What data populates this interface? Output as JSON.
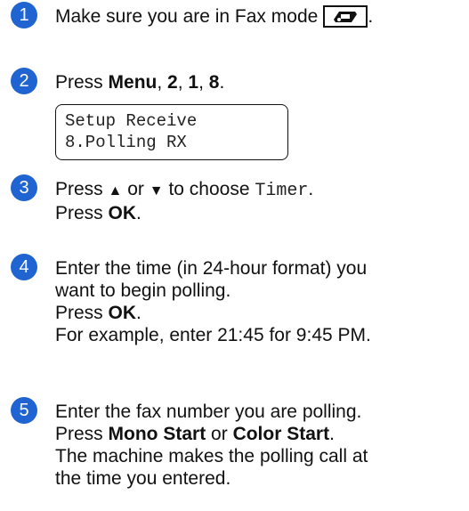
{
  "steps": [
    {
      "number": "1",
      "lines": [
        {
          "text": "Make sure you are in Fax mode",
          "key_icon": "fax-mode-icon",
          "after": "."
        }
      ]
    },
    {
      "number": "2",
      "press": "Press",
      "menu": "Menu",
      "sep1": ",",
      "k2": "2",
      "sep2": ",",
      "k1": "1",
      "sep3": ",",
      "k8": "8",
      "end": "."
    },
    {
      "number": "3",
      "line1_press": "Press",
      "up_glyph": "▲",
      "or": "or",
      "down_glyph": "▼",
      "to_choose": "to choose",
      "option": "Timer",
      "line1_end": ".",
      "line2_press": "Press",
      "line2_key": "OK",
      "line2_end": "."
    },
    {
      "number": "4",
      "line1": "Enter the time (in 24-hour format) you",
      "line2": "want to begin polling.",
      "line3_press": "Press",
      "line3_key": "OK",
      "line3_end": ".",
      "line4": "For example, enter 21:45 for 9:45 PM."
    },
    {
      "number": "5",
      "line1": "Enter the fax number you are polling.",
      "line2_press": "Press",
      "line2_key1": "Mono Start",
      "line2_or": "or",
      "line2_key2": "Color Start",
      "line2_end": ".",
      "line3": "The machine makes the polling call at",
      "line4": "the time you entered."
    }
  ],
  "lcd": {
    "line1": "Setup Receive",
    "line2": "8.Polling RX"
  },
  "colors": {
    "step_badge": "#1f64d0"
  }
}
